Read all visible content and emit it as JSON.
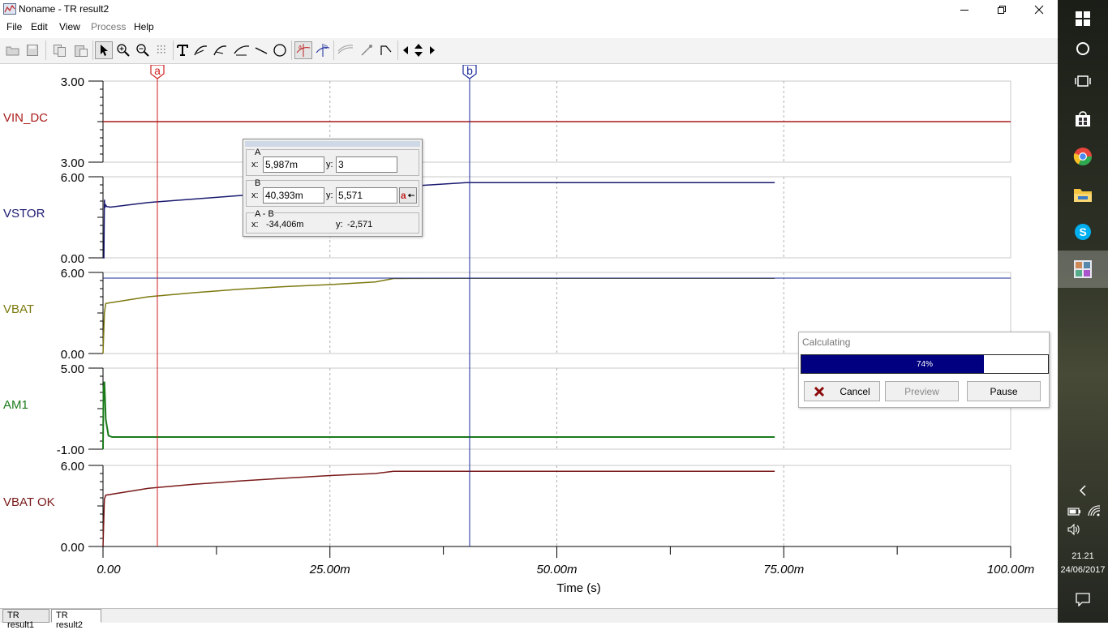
{
  "window": {
    "title": "Noname - TR result2"
  },
  "menu": [
    "File",
    "Edit",
    "View",
    "Process",
    "Help"
  ],
  "plot": {
    "cursor_a_label": "a",
    "cursor_b_label": "b",
    "x_ticks": [
      "0.00",
      "25.00m",
      "50.00m",
      "75.00m",
      "100.00m"
    ],
    "x_label": "Time (s)"
  },
  "cursor_dialog": {
    "a_label": "A",
    "a_x": "5,987m",
    "a_y": "3",
    "b_label": "B",
    "b_x": "40,393m",
    "b_y": "5,571",
    "diff_label": "A - B",
    "diff_x": "-34,406m",
    "diff_y": "-2,571",
    "x_prefix": "x:",
    "y_prefix": "y:"
  },
  "calculating_dialog": {
    "title": "Calculating",
    "progress": 0.74,
    "progress_text": "74%",
    "cancel_label": "Cancel",
    "preview_label": "Preview",
    "pause_label": "Pause"
  },
  "tabs": [
    "TR result1",
    "TR result2"
  ],
  "taskbar": {
    "time": "21.21",
    "date": "24/06/2017"
  },
  "chart_data": {
    "type": "line",
    "title": "",
    "xlabel": "Time (s)",
    "x_ticks": [
      "0.00",
      "25.00m",
      "50.00m",
      "75.00m",
      "100.00m"
    ],
    "xlim": [
      0,
      0.1
    ],
    "cursors": [
      {
        "name": "a",
        "x": 0.005987,
        "color": "#d02020"
      },
      {
        "name": "b",
        "x": 0.040393,
        "color": "#1a2a9a"
      }
    ],
    "panels": [
      {
        "name": "VIN_DC",
        "color": "#aa1a1a",
        "y_ticks": [
          "3.00",
          "3.00"
        ],
        "ylim": [
          2.5,
          3.5
        ],
        "x": [
          0,
          0.1
        ],
        "values": [
          3.0,
          3.0
        ]
      },
      {
        "name": "VSTOR",
        "color": "#1a1a70",
        "y_ticks": [
          "6.00",
          "0.00"
        ],
        "ylim": [
          0,
          6
        ],
        "x": [
          0,
          0.0001,
          0.00015,
          0.0002,
          0.0003,
          0.0004,
          0.0008,
          0.005,
          0.01,
          0.015,
          0.02,
          0.025,
          0.03,
          0.035,
          0.04,
          0.05,
          0.06,
          0.074
        ],
        "values": [
          0,
          0,
          4.3,
          3.7,
          3.9,
          3.8,
          3.75,
          4.1,
          4.35,
          4.6,
          4.85,
          5.05,
          5.2,
          5.35,
          5.57,
          5.57,
          5.57,
          5.57
        ]
      },
      {
        "name": "VBAT",
        "color": "#7d7a10",
        "y_ticks": [
          "6.00",
          "0.00"
        ],
        "ylim": [
          0,
          6
        ],
        "x": [
          0,
          0.00015,
          0.0003,
          0.005,
          0.01,
          0.015,
          0.02,
          0.025,
          0.03,
          0.032,
          0.04,
          0.05,
          0.074
        ],
        "values": [
          0,
          3.0,
          3.7,
          4.2,
          4.5,
          4.75,
          4.95,
          5.1,
          5.3,
          5.55,
          5.57,
          5.57,
          5.57
        ]
      },
      {
        "name": "AM1",
        "color": "#1a7a1a",
        "y_ticks": [
          "5.00",
          "-1.00"
        ],
        "ylim": [
          -1,
          5
        ],
        "x": [
          0,
          5e-05,
          0.00015,
          0.0003,
          0.0006,
          0.001,
          0.032,
          0.074
        ],
        "values": [
          -1,
          3.5,
          4.0,
          1.2,
          0,
          -0.1,
          -0.1,
          -0.1
        ]
      },
      {
        "name": "VBAT OK",
        "color": "#7a1a1a",
        "y_ticks": [
          "6.00",
          "0.00"
        ],
        "ylim": [
          0,
          6
        ],
        "x": [
          0,
          0.00015,
          0.0003,
          0.005,
          0.01,
          0.015,
          0.02,
          0.025,
          0.03,
          0.032,
          0.04,
          0.05,
          0.074
        ],
        "values": [
          0,
          3.5,
          3.8,
          4.3,
          4.6,
          4.85,
          5.05,
          5.25,
          5.4,
          5.57,
          5.57,
          5.57,
          5.57
        ]
      }
    ]
  }
}
